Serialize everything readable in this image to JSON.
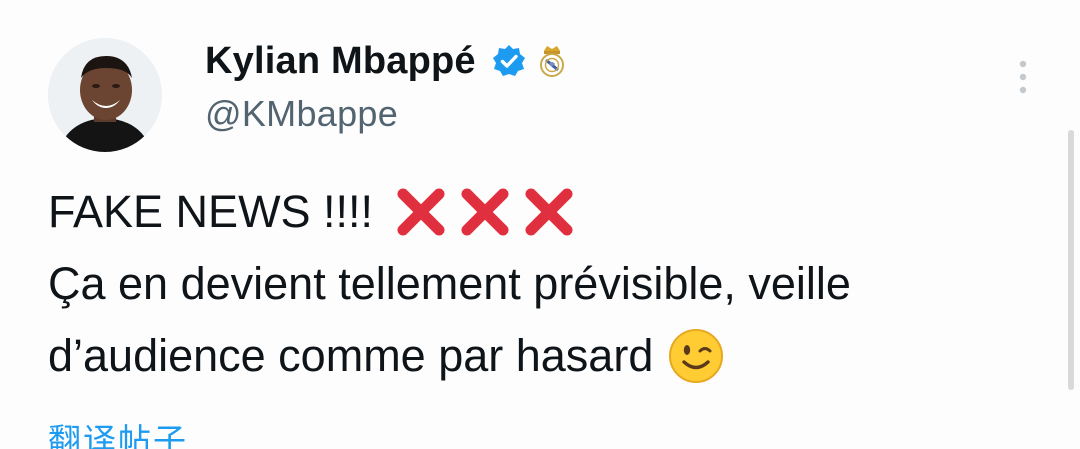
{
  "tweet": {
    "author": {
      "display_name": "Kylian Mbappé",
      "handle": "@KMbappe",
      "verified_icon": "verified-badge-icon",
      "affiliation_icon": "real-madrid-crest-icon"
    },
    "text_line_1": "FAKE NEWS !!!!",
    "text_line_1_emoji": "cross-mark-x3",
    "text_line_2": "Ça en devient tellement prévisible, veille",
    "text_line_3": "d’audience comme par hasard",
    "text_line_3_emoji": "winking-face",
    "translate_label": "翻译帖子"
  },
  "colors": {
    "text": "#0f1419",
    "secondary_text": "#536471",
    "accent": "#1d9bf0",
    "verified": "#1d9bf0",
    "cross": "#e0303f",
    "emoji_yellow": "#ffcc33"
  }
}
